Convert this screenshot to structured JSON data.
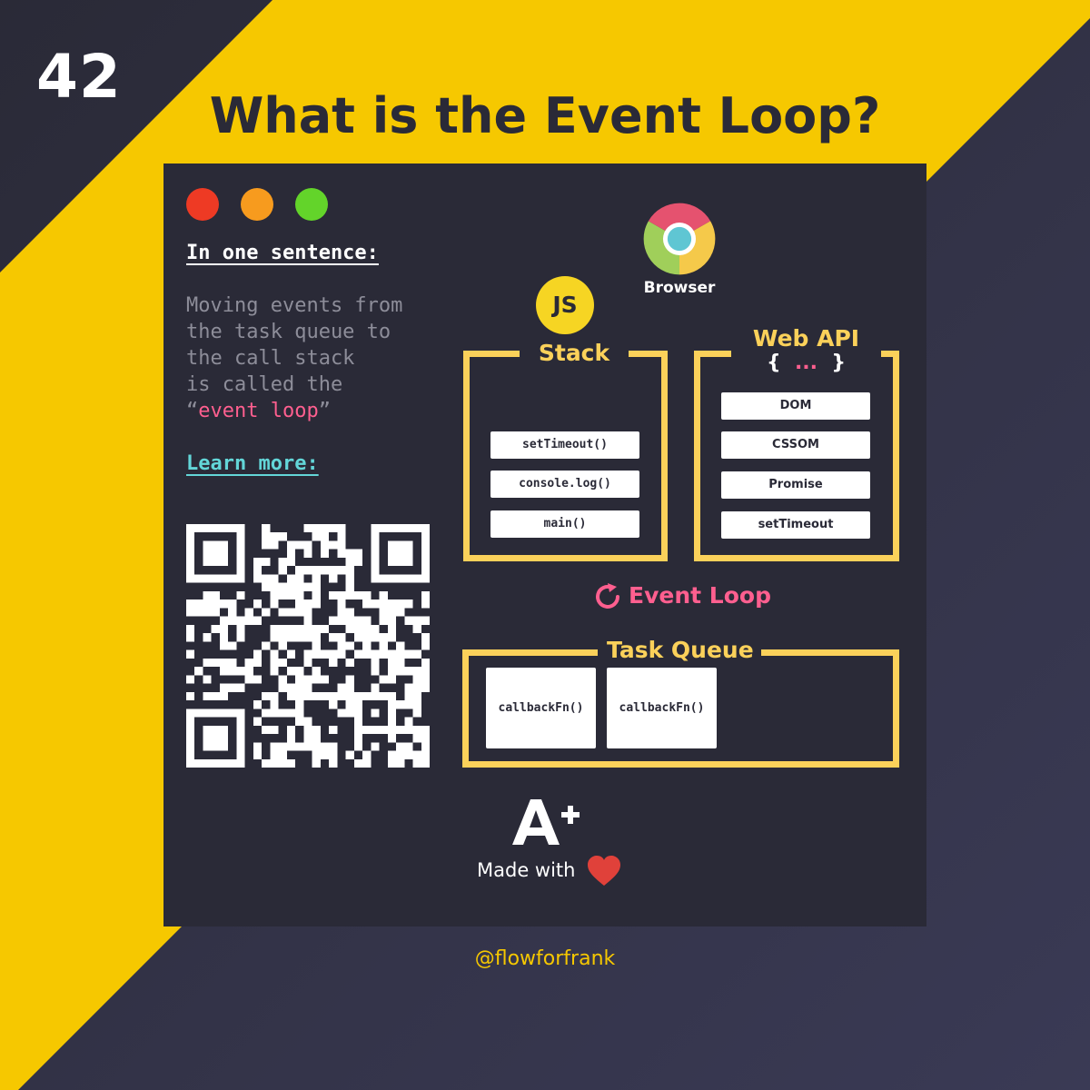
{
  "post_number": "42",
  "title": "What is the Event Loop?",
  "window_dots": [
    "#ee3a24",
    "#f79b1e",
    "#63d42a"
  ],
  "intro": {
    "heading": "In one sentence:",
    "lines": [
      "Moving events from",
      "the task queue to",
      "the call stack",
      "is called the"
    ],
    "quote_open": "“",
    "highlight": "event loop",
    "quote_close": "”",
    "learn_more": "Learn more:"
  },
  "diagram": {
    "browser_label": "Browser",
    "js_badge": "JS",
    "stack": {
      "label": "Stack",
      "items": [
        "setTimeout()",
        "console.log()",
        "main()"
      ]
    },
    "web_api": {
      "label": "Web API",
      "braces_open": "{",
      "ellipsis": "...",
      "braces_close": "}",
      "items": [
        "DOM",
        "CSSOM",
        "Promise",
        "setTimeout"
      ]
    },
    "event_loop_label": "Event Loop",
    "task_queue": {
      "label": "Task Queue",
      "items": [
        "callbackFn()",
        "callbackFn()"
      ]
    }
  },
  "footer": {
    "logo_text": "A+",
    "made_with": "Made with",
    "handle": "@flowforfrank"
  },
  "colors": {
    "yellow": "#f6c800",
    "dark": "#2a2a37",
    "accent_frame": "#fbd15a",
    "pink": "#ff5f8f",
    "teal": "#63d6d8",
    "heart": "#e0413a"
  }
}
